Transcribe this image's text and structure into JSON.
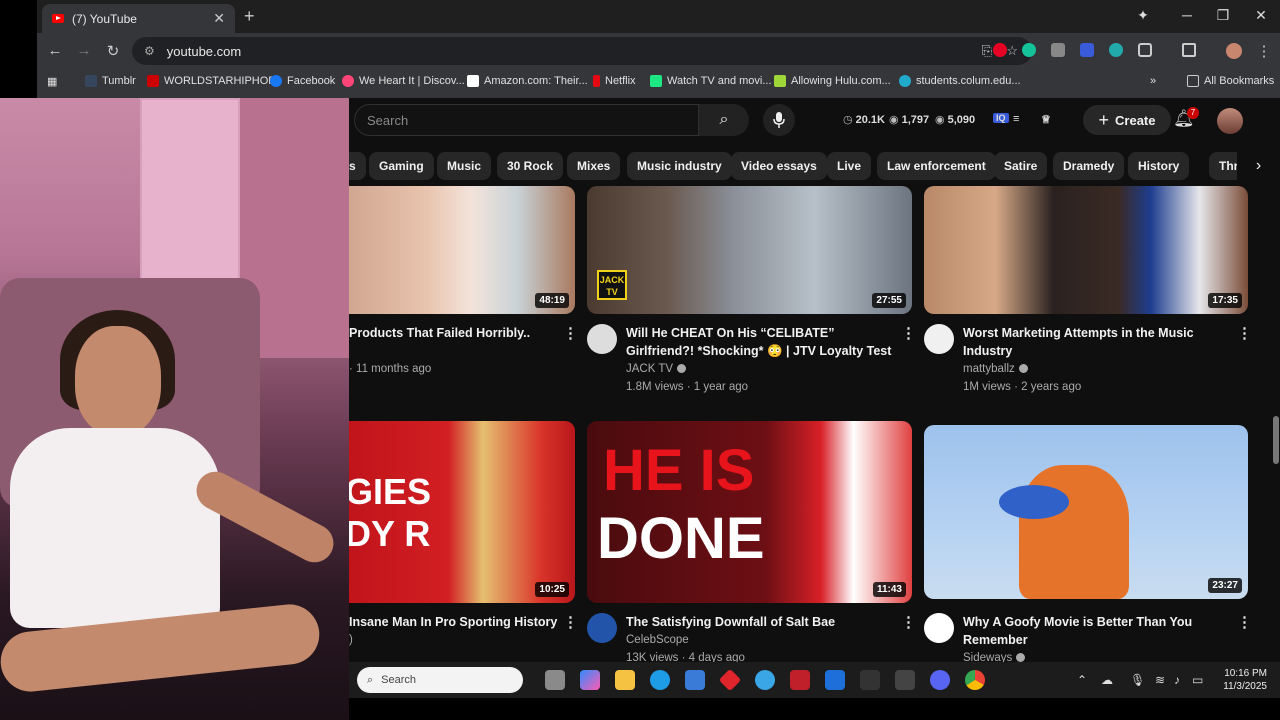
{
  "browser": {
    "tab_title": "(7) YouTube",
    "url": "youtube.com",
    "bookmarks": [
      {
        "label": "Tumblr",
        "color": "#36465d"
      },
      {
        "label": "WORLDSTARHIPHOP",
        "color": "#c00"
      },
      {
        "label": "Facebook",
        "color": "#1877f2"
      },
      {
        "label": "We Heart It | Discov...",
        "color": "#ff4477"
      },
      {
        "label": "Amazon.com: Their...",
        "color": "#ffffff"
      },
      {
        "label": "Netflix",
        "color": "#e50914"
      },
      {
        "label": "Watch TV and movi...",
        "color": "#1ce783"
      },
      {
        "label": "Allowing Hulu.com...",
        "color": "#9fd638"
      },
      {
        "label": "students.colum.edu...",
        "color": "#22aacc"
      }
    ],
    "all_bookmarks": "All Bookmarks"
  },
  "youtube": {
    "search_placeholder": "Search",
    "stats": {
      "likes": "20.1K",
      "views": "1,797",
      "watch": "5,090"
    },
    "create_label": "Create",
    "notification_count": "7",
    "chips": [
      "s",
      "Gaming",
      "Music",
      "30 Rock",
      "Mixes",
      "Music industry",
      "Video essays",
      "Live",
      "Law enforcement",
      "Satire",
      "Dramedy",
      "History",
      "Thrille"
    ],
    "videos": [
      {
        "title": "Products That Failed Horribly..",
        "channel": "",
        "meta": "· 11 months ago",
        "duration": "48:19"
      },
      {
        "title": "Will He CHEAT On His “CELIBATE” Girlfriend?! *Shocking* 😳 | JTV Loyalty Test",
        "channel": "JACK TV",
        "meta": "1.8M views · 1 year ago",
        "duration": "27:55",
        "thumb_badge": "JACK TV"
      },
      {
        "title": "Worst Marketing Attempts in the Music Industry",
        "channel": "mattyballz",
        "meta": "1M views · 2 years ago",
        "duration": "17:35"
      },
      {
        "title": "Insane Man In Pro Sporting History",
        "channel": "",
        "meta": ")",
        "duration": "10:25",
        "thumb_text": "GIES DY R"
      },
      {
        "title": "The Satisfying Downfall of Salt Bae",
        "channel": "CelebScope",
        "meta": "13K views · 4 days ago",
        "duration": "11:43",
        "thumb_text_1": "HE IS",
        "thumb_text_2": "DONE"
      },
      {
        "title": "Why A Goofy Movie is Better Than You Remember",
        "channel": "Sideways",
        "meta": "",
        "duration": "23:27"
      }
    ]
  },
  "taskbar": {
    "search_placeholder": "Search",
    "time": "10:16 PM",
    "date": "11/3/2025"
  }
}
